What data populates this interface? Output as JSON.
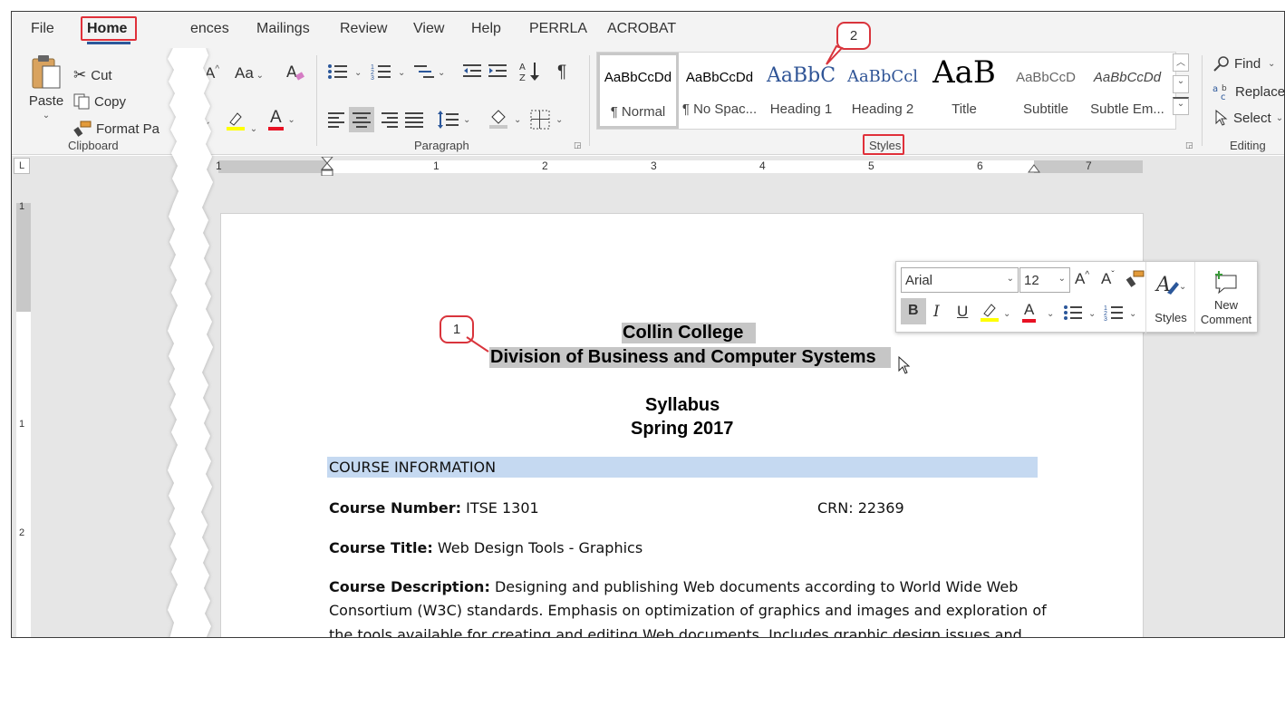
{
  "menu": {
    "tabs": [
      "File",
      "Home",
      "References",
      "Mailings",
      "Review",
      "View",
      "Help",
      "PERRLA",
      "ACROBAT"
    ],
    "visible_tabs": {
      "file": "File",
      "home": "Home",
      "references_partial": "ences",
      "mailings": "Mailings",
      "review": "Review",
      "view": "View",
      "help": "Help",
      "perrla": "PERRLA",
      "acrobat": "ACROBAT"
    },
    "active": "Home"
  },
  "clipboard": {
    "paste": "Paste",
    "cut": "Cut",
    "copy": "Copy",
    "format_painter": "Format Pa",
    "label": "Clipboard"
  },
  "font": {
    "case_label": "Aa",
    "grow": "A",
    "font_color": "A"
  },
  "paragraph": {
    "label": "Paragraph",
    "pilcrow": "¶"
  },
  "styles": {
    "label": "Styles",
    "tiles": [
      {
        "sample": "AaBbCcDd",
        "name": "¶ Normal",
        "selected": true
      },
      {
        "sample": "AaBbCcDd",
        "name": "¶ No Spac...",
        "selected": false
      },
      {
        "sample": "AaBbC",
        "name": "Heading 1",
        "selected": false
      },
      {
        "sample": "AaBbCcl",
        "name": "Heading 2",
        "selected": false
      },
      {
        "sample": "AaB",
        "name": "Title",
        "selected": false
      },
      {
        "sample": "AaBbCcD",
        "name": "Subtitle",
        "selected": false
      },
      {
        "sample": "AaBbCcDd",
        "name": "Subtle Em...",
        "selected": false
      }
    ]
  },
  "editing": {
    "find": "Find",
    "replace": "Replace",
    "select": "Select",
    "label": "Editing"
  },
  "ruler": {
    "h_numbers": [
      "1",
      "1",
      "2",
      "3",
      "4",
      "5",
      "6",
      "7"
    ],
    "v_numbers": [
      "1",
      "1",
      "2"
    ],
    "tab_stop": "L"
  },
  "document": {
    "college": "Collin College",
    "division": "Division of Business and Computer Systems",
    "syllabus": "Syllabus",
    "term": "Spring 2017",
    "section_heading": "COURSE INFORMATION",
    "course_number_label": "Course Number:",
    "course_number": "ITSE 1301",
    "crn": "CRN: 22369",
    "course_title_label": "Course Title:",
    "course_title": "Web Design Tools - Graphics",
    "course_description_label": "Course Description:",
    "description_line1": "Designing and publishing Web documents according to World Wide Web",
    "description_line2": "Consortium (W3C) standards. Emphasis on optimization of graphics and images and exploration of",
    "description_line3": "the tools available for creating and editing Web documents. Includes graphic design issues and"
  },
  "mini_toolbar": {
    "font": "Arial",
    "size": "12",
    "bold": "B",
    "italic": "I",
    "underline": "U",
    "styles": "Styles",
    "new_comment_line1": "New",
    "new_comment_line2": "Comment"
  },
  "callouts": {
    "one": "1",
    "two": "2"
  },
  "colors": {
    "accent": "#2b579a",
    "highlight_box": "#e0303a",
    "section_bar": "#c5d9f1",
    "selection": "#c6c6c6",
    "font_color_bar": "#e81123",
    "highlight_color_bar": "#ffff00"
  }
}
